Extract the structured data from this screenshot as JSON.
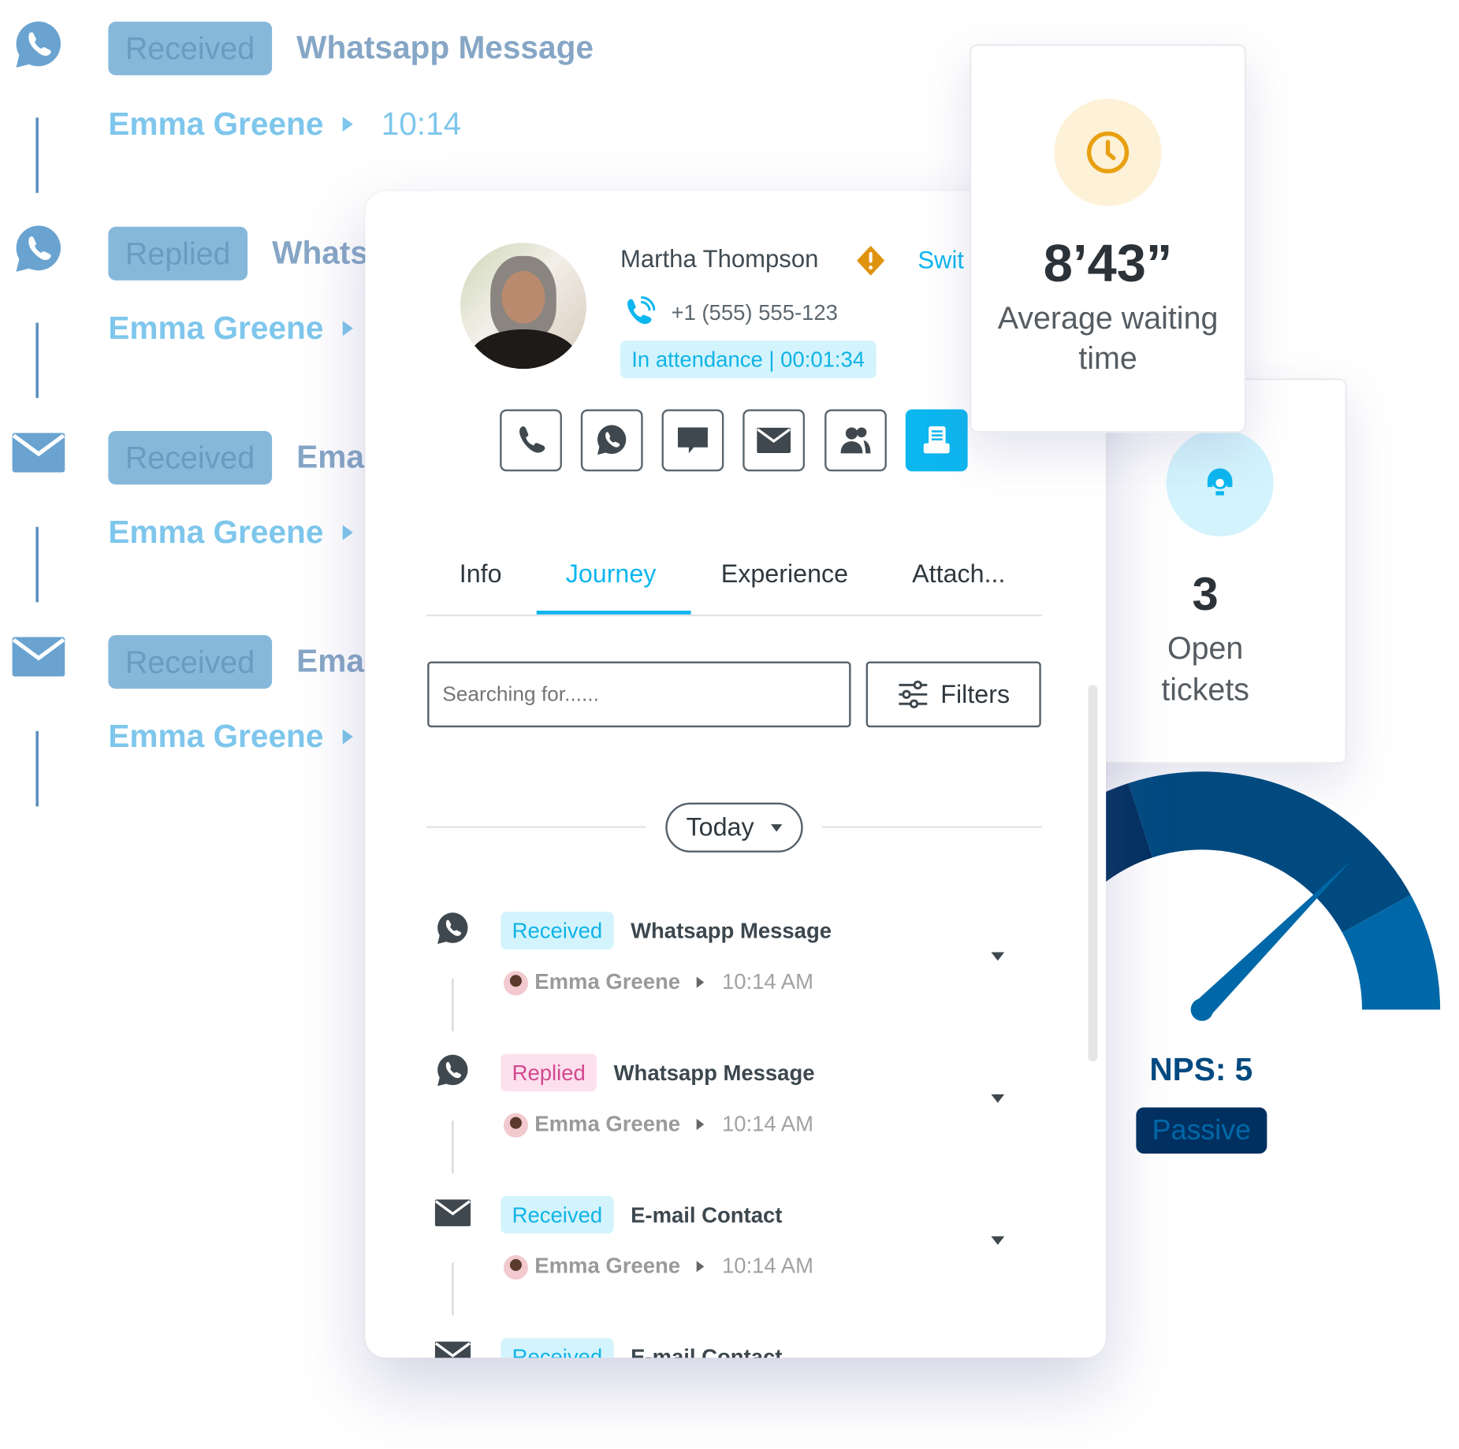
{
  "background_journey": {
    "items": [
      {
        "icon": "whatsapp-icon",
        "badge": "Received",
        "title": "Whatsapp Message",
        "name": "Emma Greene",
        "time": "10:14"
      },
      {
        "icon": "whatsapp-icon",
        "badge": "Replied",
        "title": "Whats",
        "name": "Emma Greene"
      },
      {
        "icon": "mail-icon",
        "badge": "Received",
        "title": "Emai",
        "name": "Emma Greene"
      },
      {
        "icon": "mail-icon",
        "badge": "Received",
        "title": "Emai",
        "name": "Emma Greene"
      }
    ]
  },
  "contact": {
    "name": "Martha Thompson",
    "warning_icon": "warning-diamond-icon",
    "switch_label": "Swit",
    "phone": "+1 (555) 555-123",
    "status": "In attendance | 00:01:34"
  },
  "actions": [
    {
      "icon": "phone-icon"
    },
    {
      "icon": "whatsapp-icon"
    },
    {
      "icon": "chat-icon"
    },
    {
      "icon": "mail-icon"
    },
    {
      "icon": "contacts-icon"
    },
    {
      "icon": "notes-icon",
      "active": true
    }
  ],
  "tabs": [
    {
      "label": "Info"
    },
    {
      "label": "Journey",
      "active": true
    },
    {
      "label": "Experience"
    },
    {
      "label": "Attach..."
    }
  ],
  "search": {
    "placeholder": "Searching for......",
    "value": ""
  },
  "filters_label": "Filters",
  "date_filter": "Today",
  "journey": [
    {
      "icon": "whatsapp-icon",
      "badge": "Received",
      "badge_type": "received",
      "title": "Whatsapp Message",
      "name": "Emma Greene",
      "time": "10:14 AM"
    },
    {
      "icon": "whatsapp-icon",
      "badge": "Replied",
      "badge_type": "replied",
      "title": "Whatsapp Message",
      "name": "Emma Greene",
      "time": "10:14 AM"
    },
    {
      "icon": "mail-icon",
      "badge": "Received",
      "badge_type": "received",
      "title": "E-mail Contact",
      "name": "Emma Greene",
      "time": "10:14 AM"
    },
    {
      "icon": "mail-icon",
      "badge": "Received",
      "badge_type": "received",
      "title": "E-mail Contact"
    }
  ],
  "stats": {
    "waiting": {
      "value": "8’43”",
      "label_line1": "Average waiting",
      "label_line2": "time",
      "icon": "clock-icon"
    },
    "tickets": {
      "value": "3",
      "label_line1": "Open",
      "label_line2": "tickets",
      "icon": "headset-icon"
    }
  },
  "nps": {
    "label": "NPS: 5",
    "category": "Passive",
    "needle_level": 0.75,
    "segment_bounds": [
      0,
      0.4,
      0.84,
      1
    ]
  },
  "colors": {
    "accent": "#0cb6ef",
    "badge_received_bg": "#d3f4fd",
    "badge_replied_bg": "#fde0ee",
    "badge_replied_text": "#d2498f",
    "warning": "#e0930f",
    "gauge_1": "#003060",
    "gauge_2": "#004a80",
    "gauge_3": "#0068a8"
  }
}
